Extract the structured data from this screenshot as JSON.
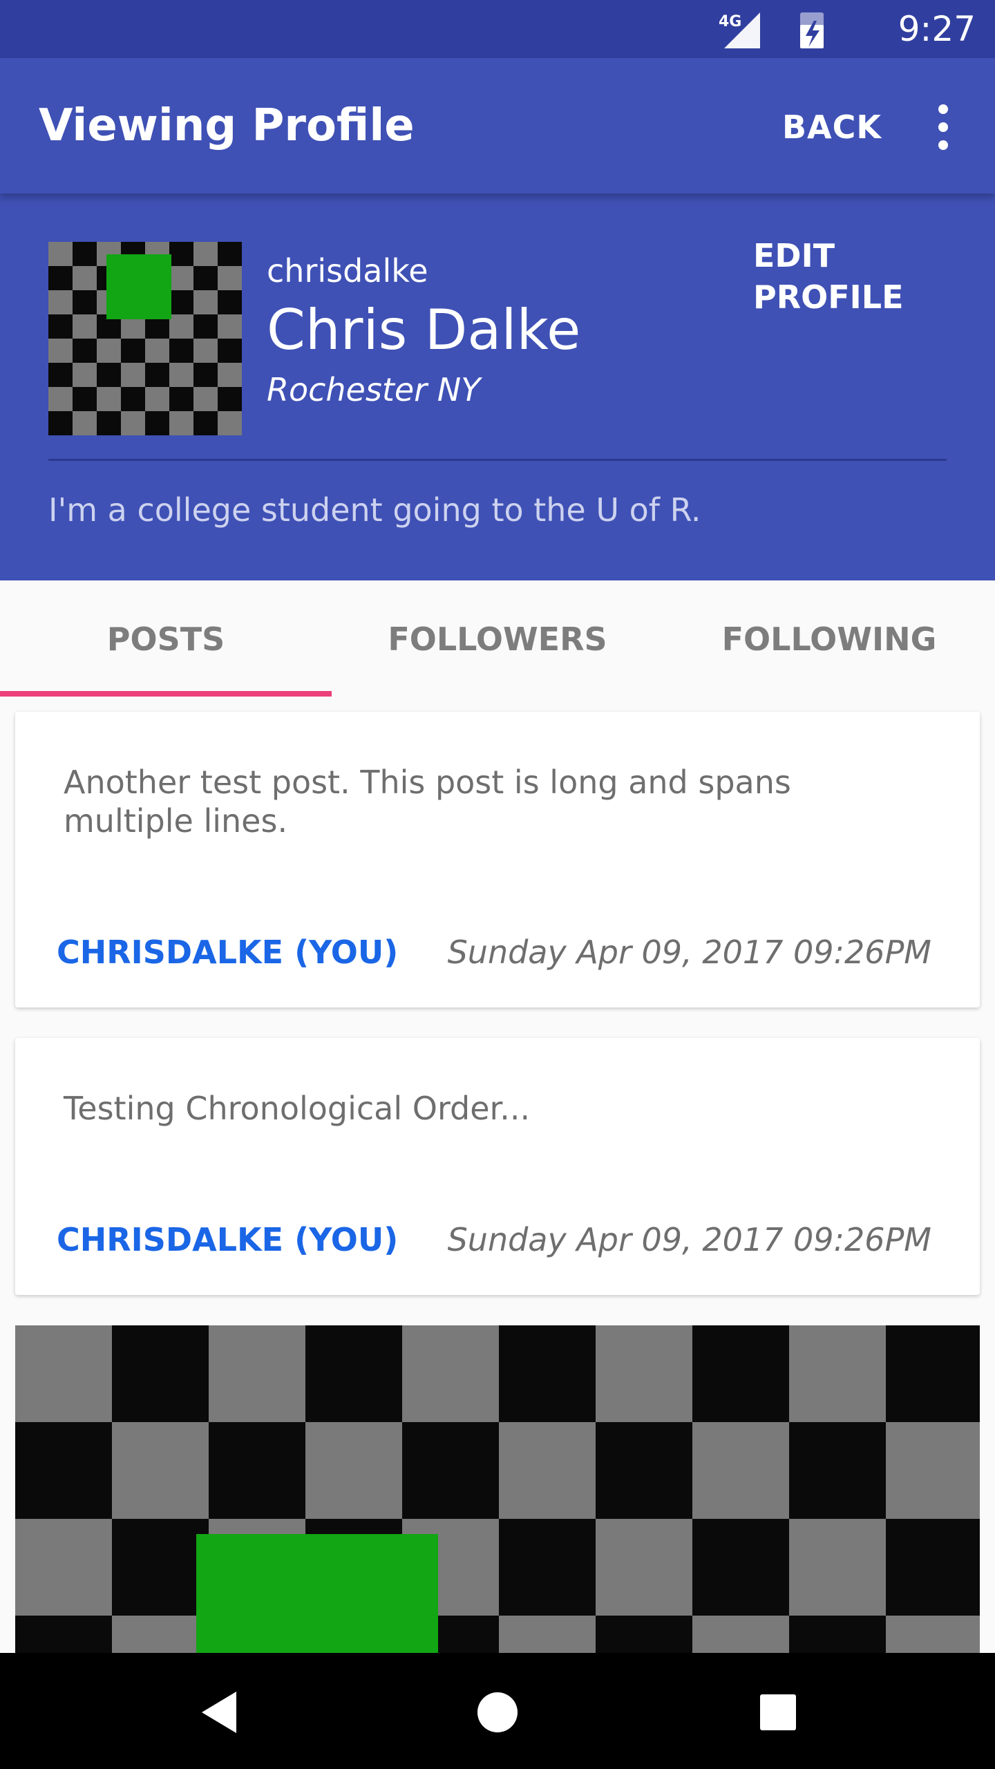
{
  "status_bar": {
    "time": "9:27",
    "network": "4G"
  },
  "app_bar": {
    "title": "Viewing Profile",
    "back_label": "BACK"
  },
  "profile": {
    "username": "chrisdalke",
    "name": "Chris Dalke",
    "location": "Rochester NY",
    "edit_label": "EDIT PROFILE",
    "bio": "I'm a college student going to the U of R."
  },
  "tabs": [
    {
      "label": "POSTS",
      "selected": true
    },
    {
      "label": "FOLLOWERS",
      "selected": false
    },
    {
      "label": "FOLLOWING",
      "selected": false
    }
  ],
  "posts": [
    {
      "text": "Another test post. This post is long and spans multiple lines.",
      "author": "CHRISDALKE (YOU)",
      "date": "Sunday Apr 09, 2017 09:26PM"
    },
    {
      "text": "Testing Chronological Order...",
      "author": "CHRISDALKE (YOU)",
      "date": "Sunday Apr 09, 2017 09:26PM"
    }
  ],
  "colors": {
    "primary": "#3f51b5",
    "primary_dark": "#303f9f",
    "tab_indicator": "#ec407a",
    "author_link": "#1a66e6"
  },
  "icons": [
    "signal-4g-icon",
    "battery-charging-icon",
    "more-vert-icon",
    "nav-back-icon",
    "nav-home-icon",
    "nav-recents-icon"
  ]
}
